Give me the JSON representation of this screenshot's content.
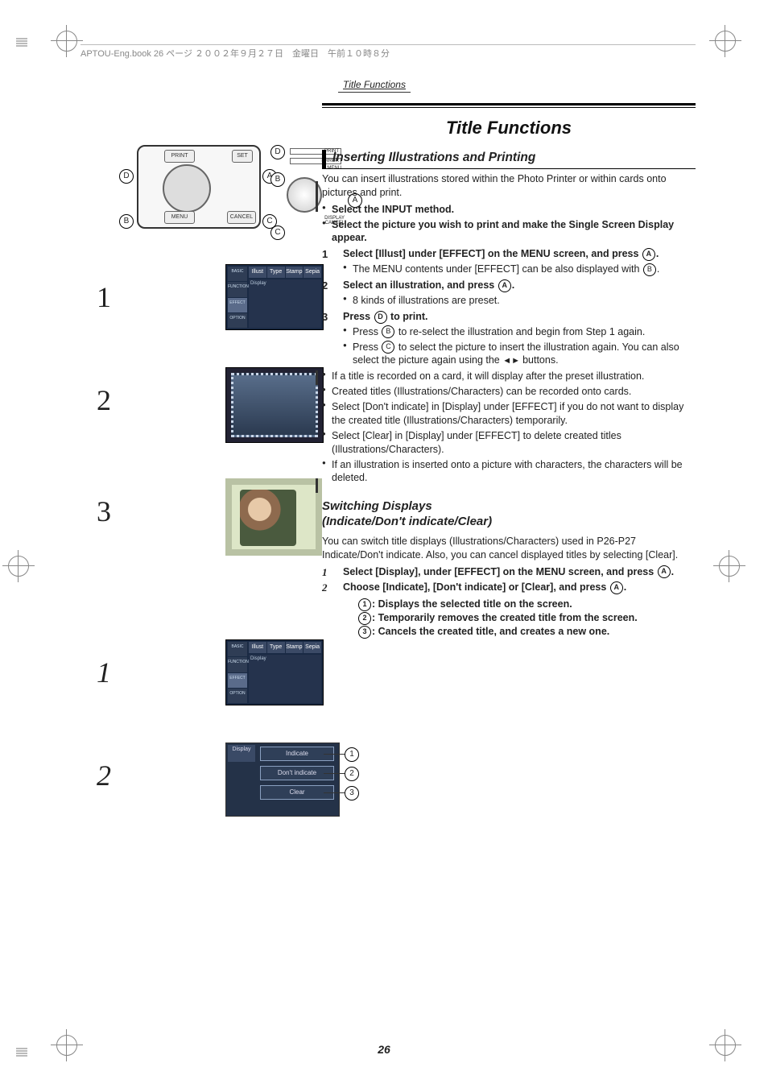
{
  "header": {
    "generator_line": "APTOU-Eng.book  26 ページ  ２００２年９月２７日　金曜日　午前１０時８分",
    "running_head": "Title Functions"
  },
  "main_title": "Title Functions",
  "section1": {
    "heading": "Inserting Illustrations and Printing",
    "intro": "You can insert illustrations stored within the Photo Printer or within cards onto pictures and print.",
    "pre_steps": [
      "Select the INPUT method.",
      "Select the picture you wish to print and make the Single Screen Display appear."
    ],
    "steps": {
      "s1": {
        "num": "1",
        "text1": "Select [Illust] under [EFFECT] on the MENU screen, and press ",
        "note1": "The MENU contents under [EFFECT] can be also displayed with "
      },
      "s2": {
        "num": "2",
        "text1": "Select an illustration, and press ",
        "note1": "8 kinds of illustrations are preset."
      },
      "s3": {
        "num": "3",
        "text1_a": "Press ",
        "text1_b": " to print.",
        "noteB_a": "Press ",
        "noteB_b": " to re-select the illustration and begin from Step 1 again.",
        "noteC_a": "Press ",
        "noteC_b": " to select the picture to insert the illustration again. You can also select the picture again using the ",
        "noteC_c": " buttons."
      }
    },
    "post_bullets": [
      "If a title is recorded on a card, it will display after the preset illustration.",
      "Created titles (Illustrations/Characters) can be recorded onto cards.",
      "Select [Don't indicate] in [Display] under [EFFECT] if you do not want to display the created title (Illustrations/Characters) temporarily.",
      "Select [Clear] in [Display] under [EFFECT] to delete created titles (Illustrations/Characters).",
      "If an illustration is inserted onto a picture with characters, the characters will be deleted."
    ]
  },
  "section2": {
    "heading_line1": "Switching Displays",
    "heading_line2": "(Indicate/Don't indicate/Clear)",
    "intro": "You can switch title displays (Illustrations/Characters) used in P26-P27 Indicate/Don't indicate. Also, you can cancel displayed titles by selecting [Clear].",
    "steps": {
      "s1": {
        "num": "1",
        "text1": "Select [Display], under [EFFECT] on the MENU screen, and press "
      },
      "s2": {
        "num": "2",
        "text1": "Choose [Indicate], [Don't indicate] or [Clear], and press "
      }
    },
    "defs": {
      "d1": ": Displays the selected title on the screen.",
      "d2": ": Temporarily removes the created title from the screen.",
      "d3": ": Cancels the created title, and creates a new one."
    }
  },
  "labels": {
    "A": "A",
    "B": "B",
    "C": "C",
    "D": "D",
    "n1": "1",
    "n2": "2",
    "n3": "3"
  },
  "buttons": {
    "print": "PRINT",
    "set": "SET",
    "menu": "MENU",
    "cancel": "CANCEL",
    "error": "ERROR",
    "display": "DISPLAY",
    "basic": "BASIC",
    "function": "FUNCTION",
    "effect": "EFFECT",
    "option": "OPTION",
    "illust": "Illust",
    "type": "Type",
    "stamp": "Stamp",
    "sepia": "Sepia",
    "display2": "Display",
    "indicate": "Indicate",
    "dont_indicate": "Don't indicate",
    "clear": "Clear"
  },
  "page_number": "26"
}
